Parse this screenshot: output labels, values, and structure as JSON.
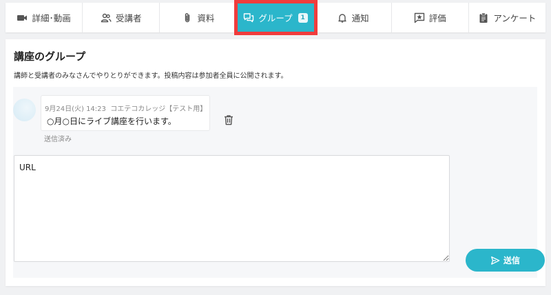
{
  "tabs": [
    {
      "label": "詳細･動画",
      "icon": "video-icon"
    },
    {
      "label": "受講者",
      "icon": "users-icon"
    },
    {
      "label": "資料",
      "icon": "paperclip-icon"
    },
    {
      "label": "グループ",
      "icon": "chat-icon",
      "badge": "1",
      "active": true
    },
    {
      "label": "通知",
      "icon": "bell-icon"
    },
    {
      "label": "評価",
      "icon": "star-comment-icon"
    },
    {
      "label": "アンケート",
      "icon": "clipboard-icon"
    }
  ],
  "page": {
    "title": "講座のグループ",
    "description": "講師と受講者のみなさんでやりとりができます。投稿内容は参加者全員に公開されます。"
  },
  "message": {
    "date": "9月24日(火) 14:23",
    "author": "コエテコカレッジ【テスト用】",
    "text": "○月○日にライブ講座を行います。",
    "status": "送信済み"
  },
  "composer": {
    "value": "URL",
    "send_label": "送信"
  },
  "colors": {
    "accent": "#2bb6cb",
    "highlight": "#f03c3c"
  }
}
